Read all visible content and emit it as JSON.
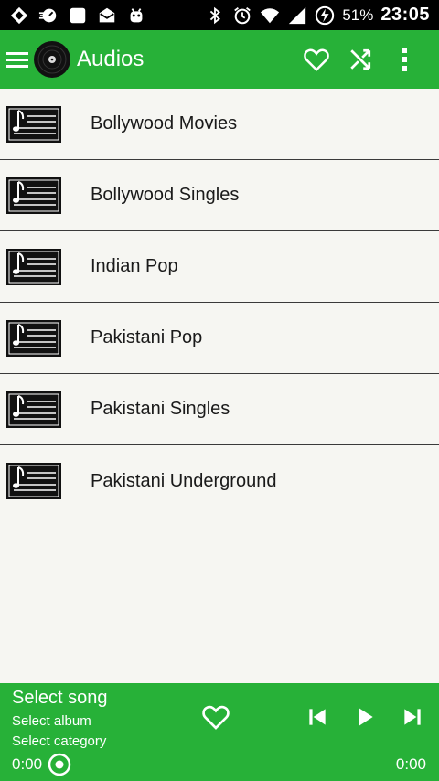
{
  "status_bar": {
    "battery_pct": "51%",
    "time": "23:05",
    "icons": [
      "dropbox-icon",
      "speed-icon",
      "square-icon",
      "mail-icon",
      "bug-icon",
      "bluetooth-icon",
      "alarm-icon",
      "wifi-icon",
      "signal-icon",
      "battery-charging-icon"
    ]
  },
  "app_bar": {
    "title": "Audios",
    "icons": [
      "menu-icon",
      "vinyl-disc-icon",
      "heart-icon",
      "shuffle-icon",
      "more-vert-icon"
    ]
  },
  "categories": [
    {
      "label": "Bollywood Movies",
      "icon": "music-note-list-icon"
    },
    {
      "label": "Bollywood Singles",
      "icon": "music-note-list-icon"
    },
    {
      "label": "Indian Pop",
      "icon": "music-note-list-icon"
    },
    {
      "label": "Pakistani Pop",
      "icon": "music-note-list-icon"
    },
    {
      "label": "Pakistani Singles",
      "icon": "music-note-list-icon"
    },
    {
      "label": "Pakistani Underground",
      "icon": "music-note-list-icon"
    }
  ],
  "player": {
    "song_title": "Select song",
    "album": "Select album",
    "category": "Select category",
    "elapsed": "0:00",
    "total": "0:00",
    "progress": 0,
    "icons": [
      "heart-icon",
      "skip-previous-icon",
      "play-icon",
      "skip-next-icon",
      "seek-knob-icon"
    ]
  },
  "colors": {
    "accent": "#27b138",
    "background": "#f6f6f2",
    "status_bar": "#000000",
    "divider": "#3a3a3a"
  }
}
